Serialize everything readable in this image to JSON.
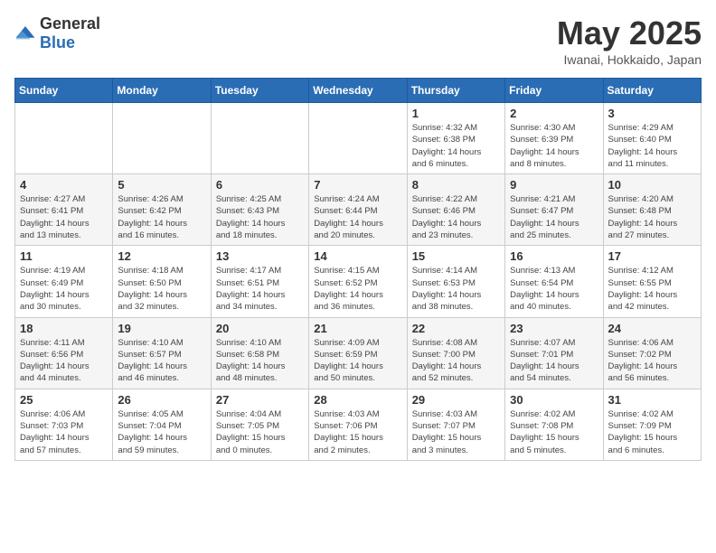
{
  "header": {
    "logo": {
      "general": "General",
      "blue": "Blue"
    },
    "title": "May 2025",
    "location": "Iwanai, Hokkaido, Japan"
  },
  "days_of_week": [
    "Sunday",
    "Monday",
    "Tuesday",
    "Wednesday",
    "Thursday",
    "Friday",
    "Saturday"
  ],
  "weeks": [
    [
      {
        "day": "",
        "info": ""
      },
      {
        "day": "",
        "info": ""
      },
      {
        "day": "",
        "info": ""
      },
      {
        "day": "",
        "info": ""
      },
      {
        "day": "1",
        "info": "Sunrise: 4:32 AM\nSunset: 6:38 PM\nDaylight: 14 hours\nand 6 minutes."
      },
      {
        "day": "2",
        "info": "Sunrise: 4:30 AM\nSunset: 6:39 PM\nDaylight: 14 hours\nand 8 minutes."
      },
      {
        "day": "3",
        "info": "Sunrise: 4:29 AM\nSunset: 6:40 PM\nDaylight: 14 hours\nand 11 minutes."
      }
    ],
    [
      {
        "day": "4",
        "info": "Sunrise: 4:27 AM\nSunset: 6:41 PM\nDaylight: 14 hours\nand 13 minutes."
      },
      {
        "day": "5",
        "info": "Sunrise: 4:26 AM\nSunset: 6:42 PM\nDaylight: 14 hours\nand 16 minutes."
      },
      {
        "day": "6",
        "info": "Sunrise: 4:25 AM\nSunset: 6:43 PM\nDaylight: 14 hours\nand 18 minutes."
      },
      {
        "day": "7",
        "info": "Sunrise: 4:24 AM\nSunset: 6:44 PM\nDaylight: 14 hours\nand 20 minutes."
      },
      {
        "day": "8",
        "info": "Sunrise: 4:22 AM\nSunset: 6:46 PM\nDaylight: 14 hours\nand 23 minutes."
      },
      {
        "day": "9",
        "info": "Sunrise: 4:21 AM\nSunset: 6:47 PM\nDaylight: 14 hours\nand 25 minutes."
      },
      {
        "day": "10",
        "info": "Sunrise: 4:20 AM\nSunset: 6:48 PM\nDaylight: 14 hours\nand 27 minutes."
      }
    ],
    [
      {
        "day": "11",
        "info": "Sunrise: 4:19 AM\nSunset: 6:49 PM\nDaylight: 14 hours\nand 30 minutes."
      },
      {
        "day": "12",
        "info": "Sunrise: 4:18 AM\nSunset: 6:50 PM\nDaylight: 14 hours\nand 32 minutes."
      },
      {
        "day": "13",
        "info": "Sunrise: 4:17 AM\nSunset: 6:51 PM\nDaylight: 14 hours\nand 34 minutes."
      },
      {
        "day": "14",
        "info": "Sunrise: 4:15 AM\nSunset: 6:52 PM\nDaylight: 14 hours\nand 36 minutes."
      },
      {
        "day": "15",
        "info": "Sunrise: 4:14 AM\nSunset: 6:53 PM\nDaylight: 14 hours\nand 38 minutes."
      },
      {
        "day": "16",
        "info": "Sunrise: 4:13 AM\nSunset: 6:54 PM\nDaylight: 14 hours\nand 40 minutes."
      },
      {
        "day": "17",
        "info": "Sunrise: 4:12 AM\nSunset: 6:55 PM\nDaylight: 14 hours\nand 42 minutes."
      }
    ],
    [
      {
        "day": "18",
        "info": "Sunrise: 4:11 AM\nSunset: 6:56 PM\nDaylight: 14 hours\nand 44 minutes."
      },
      {
        "day": "19",
        "info": "Sunrise: 4:10 AM\nSunset: 6:57 PM\nDaylight: 14 hours\nand 46 minutes."
      },
      {
        "day": "20",
        "info": "Sunrise: 4:10 AM\nSunset: 6:58 PM\nDaylight: 14 hours\nand 48 minutes."
      },
      {
        "day": "21",
        "info": "Sunrise: 4:09 AM\nSunset: 6:59 PM\nDaylight: 14 hours\nand 50 minutes."
      },
      {
        "day": "22",
        "info": "Sunrise: 4:08 AM\nSunset: 7:00 PM\nDaylight: 14 hours\nand 52 minutes."
      },
      {
        "day": "23",
        "info": "Sunrise: 4:07 AM\nSunset: 7:01 PM\nDaylight: 14 hours\nand 54 minutes."
      },
      {
        "day": "24",
        "info": "Sunrise: 4:06 AM\nSunset: 7:02 PM\nDaylight: 14 hours\nand 56 minutes."
      }
    ],
    [
      {
        "day": "25",
        "info": "Sunrise: 4:06 AM\nSunset: 7:03 PM\nDaylight: 14 hours\nand 57 minutes."
      },
      {
        "day": "26",
        "info": "Sunrise: 4:05 AM\nSunset: 7:04 PM\nDaylight: 14 hours\nand 59 minutes."
      },
      {
        "day": "27",
        "info": "Sunrise: 4:04 AM\nSunset: 7:05 PM\nDaylight: 15 hours\nand 0 minutes."
      },
      {
        "day": "28",
        "info": "Sunrise: 4:03 AM\nSunset: 7:06 PM\nDaylight: 15 hours\nand 2 minutes."
      },
      {
        "day": "29",
        "info": "Sunrise: 4:03 AM\nSunset: 7:07 PM\nDaylight: 15 hours\nand 3 minutes."
      },
      {
        "day": "30",
        "info": "Sunrise: 4:02 AM\nSunset: 7:08 PM\nDaylight: 15 hours\nand 5 minutes."
      },
      {
        "day": "31",
        "info": "Sunrise: 4:02 AM\nSunset: 7:09 PM\nDaylight: 15 hours\nand 6 minutes."
      }
    ]
  ]
}
